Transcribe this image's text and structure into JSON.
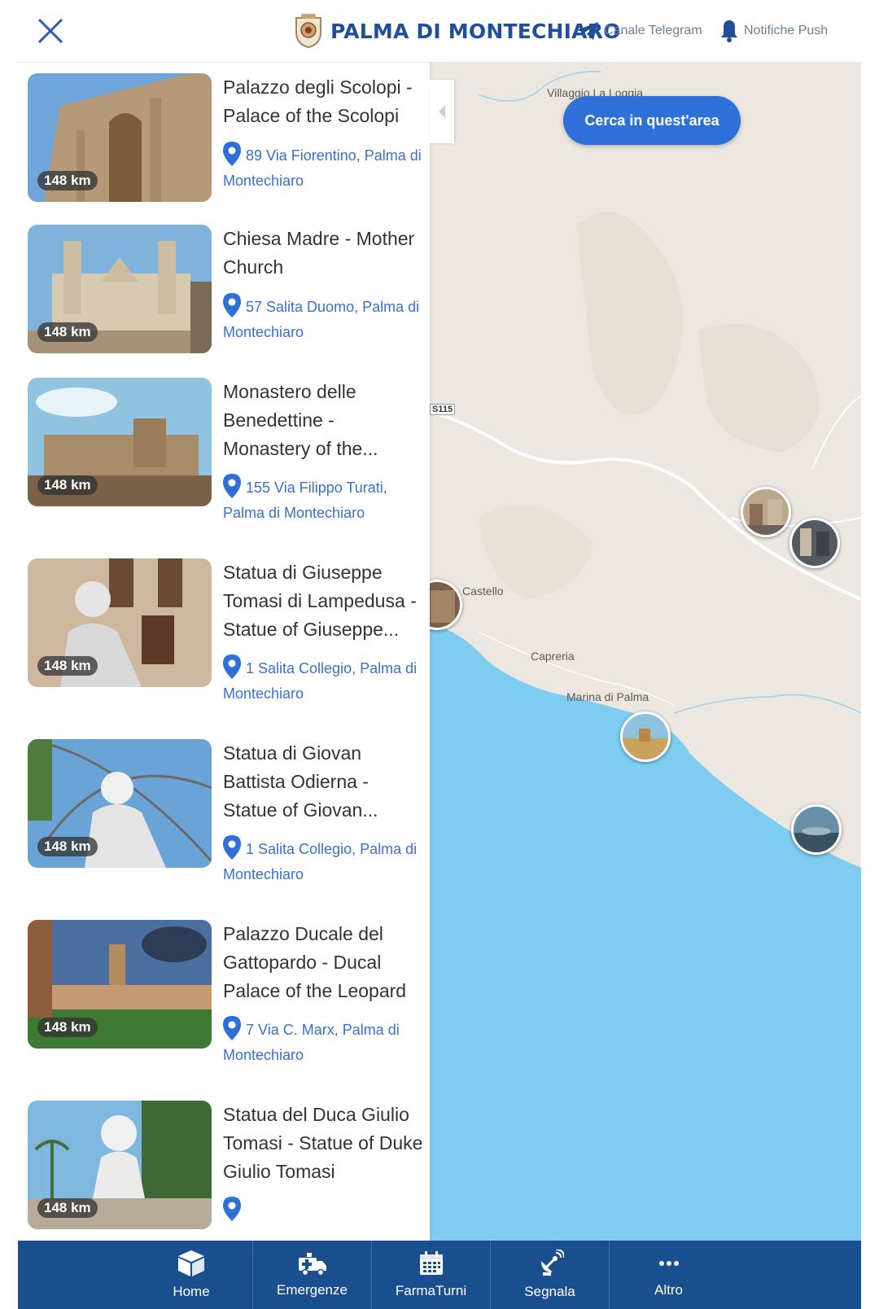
{
  "header": {
    "title": "PALMA DI MONTECHIARO",
    "telegram_label": "Canale Telegram",
    "push_label": "Notifiche Push"
  },
  "map": {
    "search_button": "Cerca in quest'area",
    "labels": [
      "Villaggio La Loggia",
      "Castello",
      "Capreria",
      "Marina di Palma"
    ],
    "road_tag": "S115",
    "sea_color": "#7ecdf0",
    "land_color": "#ece8e1"
  },
  "places": [
    {
      "title": "Palazzo degli Scolopi - Palace of the Scolopi",
      "address": "89 Via Fiorentino, Palma di Montechiaro",
      "distance": "148 km"
    },
    {
      "title": "Chiesa Madre - Mother Church",
      "address": "57 Salita Duomo, Palma di Montechiaro",
      "distance": "148 km"
    },
    {
      "title": "Monastero delle Benedettine - Monastery of the...",
      "address": "155 Via Filippo Turati, Palma di Montechiaro",
      "distance": "148 km"
    },
    {
      "title": "Statua di Giuseppe Tomasi di Lampedusa - Statue of Giuseppe...",
      "address": "1 Salita Collegio, Palma di Montechiaro",
      "distance": "148 km"
    },
    {
      "title": "Statua di Giovan Battista Odierna - Statue of Giovan...",
      "address": "1 Salita Collegio, Palma di Montechiaro",
      "distance": "148 km"
    },
    {
      "title": "Palazzo Ducale del Gattopardo - Ducal Palace of the Leopard",
      "address": "7 Via C. Marx, Palma di Montechiaro",
      "distance": "148 km"
    },
    {
      "title": "Statua del Duca Giulio Tomasi - Statue of Duke Giulio Tomasi",
      "address": "",
      "distance": "148 km"
    }
  ],
  "nav": {
    "items": [
      {
        "label": "Home",
        "icon": "box-icon"
      },
      {
        "label": "Emergenze",
        "icon": "ambulance-icon"
      },
      {
        "label": "FarmaTurni",
        "icon": "calendar-icon"
      },
      {
        "label": "Segnala",
        "icon": "satellite-icon"
      },
      {
        "label": "Altro",
        "icon": "more-icon"
      }
    ]
  },
  "colors": {
    "brand": "#1f4f99",
    "accent": "#2f6fd8",
    "nav_bg": "#1a4f8f",
    "link": "#3a6fd0"
  }
}
